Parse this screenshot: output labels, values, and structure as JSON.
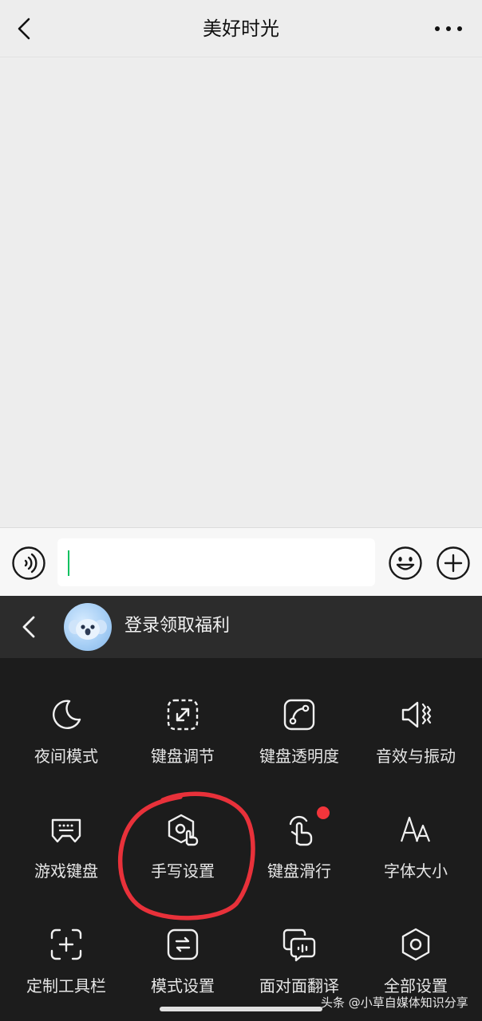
{
  "header": {
    "title": "美好时光",
    "back_icon": "chevron-left-icon",
    "more_icon": "more-horizontal-icon"
  },
  "input_bar": {
    "voice_icon": "voice-icon",
    "input_value": "",
    "emoji_icon": "emoji-icon",
    "plus_icon": "plus-circle-icon",
    "accent": "#07c160"
  },
  "keyboard_toolbar": {
    "back_icon": "chevron-left-icon",
    "login_label": "登录领取福利"
  },
  "keyboard_menu": {
    "items": [
      {
        "label": "夜间模式",
        "icon": "moon-icon"
      },
      {
        "label": "键盘调节",
        "icon": "resize-icon"
      },
      {
        "label": "键盘透明度",
        "icon": "transparency-icon"
      },
      {
        "label": "音效与振动",
        "icon": "speaker-vibrate-icon"
      },
      {
        "label": "游戏键盘",
        "icon": "game-keyboard-icon"
      },
      {
        "label": "手写设置",
        "icon": "handwriting-settings-icon"
      },
      {
        "label": "键盘滑行",
        "icon": "swipe-icon"
      },
      {
        "label": "字体大小",
        "icon": "font-size-icon"
      },
      {
        "label": "定制工具栏",
        "icon": "add-toolbar-icon"
      },
      {
        "label": "模式设置",
        "icon": "mode-switch-icon"
      },
      {
        "label": "面对面翻译",
        "icon": "translate-chat-icon"
      },
      {
        "label": "全部设置",
        "icon": "settings-hex-icon"
      }
    ]
  },
  "annotation_color": "#e8313a",
  "watermark": "头条 @小草自媒体知识分享"
}
